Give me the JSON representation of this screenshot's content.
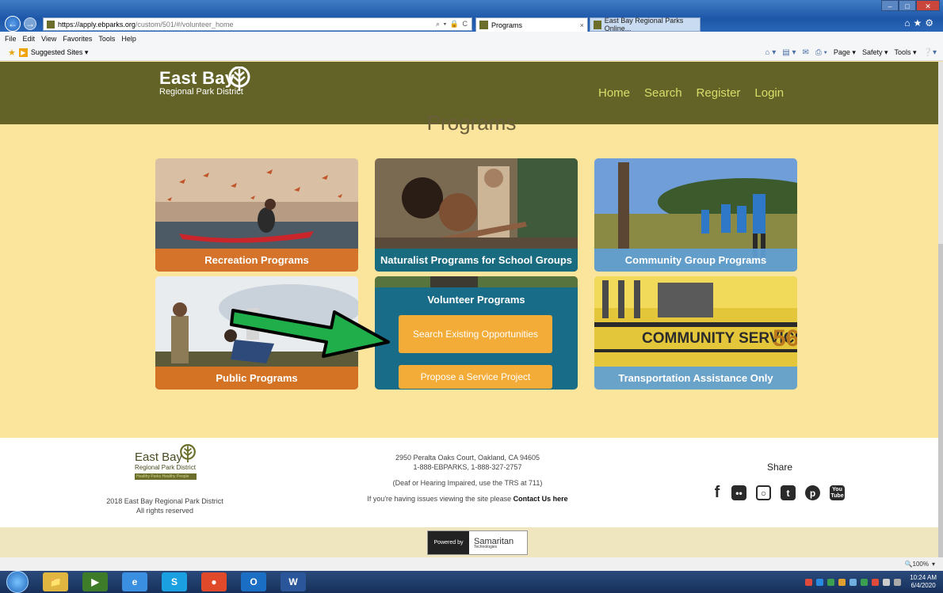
{
  "browser": {
    "url_host": "https://apply.ebparks.org",
    "url_path": "/custom/501/#/volunteer_home",
    "address_controls": "⌕ ▾ 🔒 C",
    "tabs": [
      {
        "label": "Programs",
        "active": true
      },
      {
        "label": "East Bay Regional Parks Online...",
        "active": false
      }
    ],
    "menu": [
      "File",
      "Edit",
      "View",
      "Favorites",
      "Tools",
      "Help"
    ],
    "favorites_label": "Suggested Sites ▾",
    "command_bar": [
      "Page ▾",
      "Safety ▾",
      "Tools ▾"
    ],
    "zoom": "100%"
  },
  "site": {
    "logo_main": "East Bay",
    "logo_sub": "Regional Park District",
    "nav": [
      "Home",
      "Search",
      "Register",
      "Login"
    ],
    "page_title": "Programs"
  },
  "cards": {
    "recreation": "Recreation Programs",
    "naturalist": "Naturalist Programs for School Groups",
    "community": "Community Group Programs",
    "public": "Public Programs",
    "volunteer_title": "Volunteer Programs",
    "volunteer_search": "Search Existing Opportunities",
    "volunteer_propose": "Propose a Service Project",
    "transportation": "Transportation Assistance Only",
    "bus_sign": "COMMUNITY SERVICE",
    "bus_number": "56"
  },
  "footer": {
    "logo_main": "East Bay",
    "logo_sub": "Regional Park District",
    "tagline": "Healthy Parks Healthy People",
    "copyright_line1": "2018 East Bay Regional Park District",
    "copyright_line2": "All rights reserved",
    "address": "2950 Peralta Oaks Court, Oakland, CA 94605",
    "phones": "1-888-EBPARKS, 1-888-327-2757",
    "tty": "(Deaf or Hearing Impaired, use the TRS at 711)",
    "issues_text": "If you're having issues viewing the site please ",
    "contact_link": "Contact Us here",
    "share_label": "Share",
    "powered_by": "Powered by",
    "powered_brand": "Samaritan",
    "powered_brand_sub": "Technologies"
  },
  "taskbar": {
    "time": "10:24 AM",
    "date": "6/4/2020"
  },
  "colors": {
    "header": "#636328",
    "page_bg": "#fbe49b",
    "nav_link": "#d9de6a",
    "orange": "#e07524",
    "teal": "#196c87",
    "light_blue": "#60a0d6",
    "volunteer_button": "#f3ac37",
    "arrow": "#1fae4a"
  }
}
